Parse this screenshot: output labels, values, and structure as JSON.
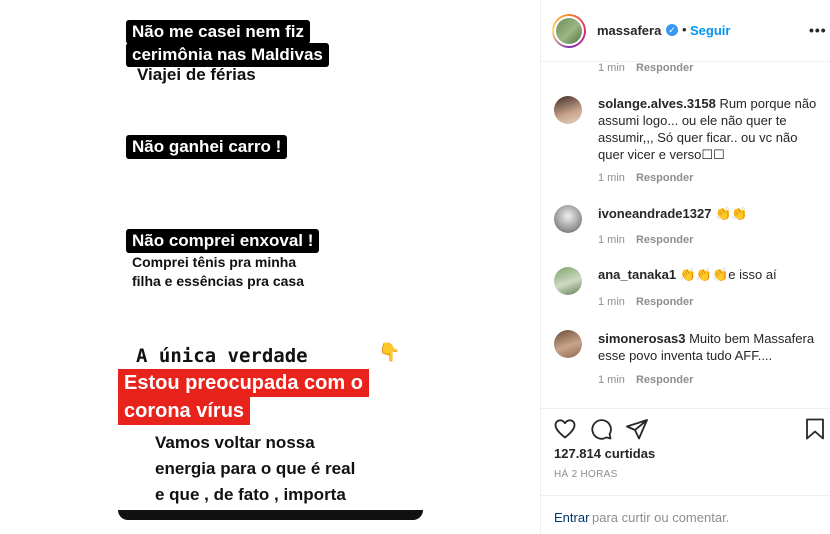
{
  "story": {
    "line1": "Não me casei  nem fiz",
    "line2": "cerimônia nas Maldivas",
    "line3": "Viajei de férias",
    "line4": "Não ganhei carro !",
    "line5": "Não comprei enxoval !",
    "line6": "Comprei tênis pra minha",
    "line7": "filha e essências pra casa",
    "line8": "A única verdade",
    "line9": "Estou preocupada com o",
    "line10": "corona vírus",
    "line11": "Vamos voltar nossa",
    "line12": "energia para o que é real",
    "line13": "e que , de fato , importa"
  },
  "header": {
    "username": "massafera",
    "dot": "•",
    "follow": "Seguir",
    "more": "•••"
  },
  "comments": [
    {
      "username": "",
      "text": "",
      "time": "1 min",
      "reply": "Responder"
    },
    {
      "username": "solange.alves.3158",
      "text": "Rum porque não assumi logo... ou ele não quer te assumir,,, Só quer ficar.. ou vc não quer vicer e verso☐☐",
      "time": "1 min",
      "reply": "Responder"
    },
    {
      "username": "ivoneandrade1327",
      "text": "👏👏",
      "time": "1 min",
      "reply": "Responder"
    },
    {
      "username": "ana_tanaka1",
      "text": "👏👏👏e isso aí",
      "time": "1 min",
      "reply": "Responder"
    },
    {
      "username": "simonerosas3",
      "text": "Muito bem Massafera esse povo inventa tudo AFF....",
      "time": "1 min",
      "reply": "Responder"
    }
  ],
  "actions": {
    "likes": "127.814 curtidas",
    "time": "HÁ 2 HORAS",
    "login": "Entrar",
    "login_rest": "para curtir ou comentar."
  },
  "colors": {
    "accent": "#0095f6",
    "red_highlight": "#e8231c"
  }
}
